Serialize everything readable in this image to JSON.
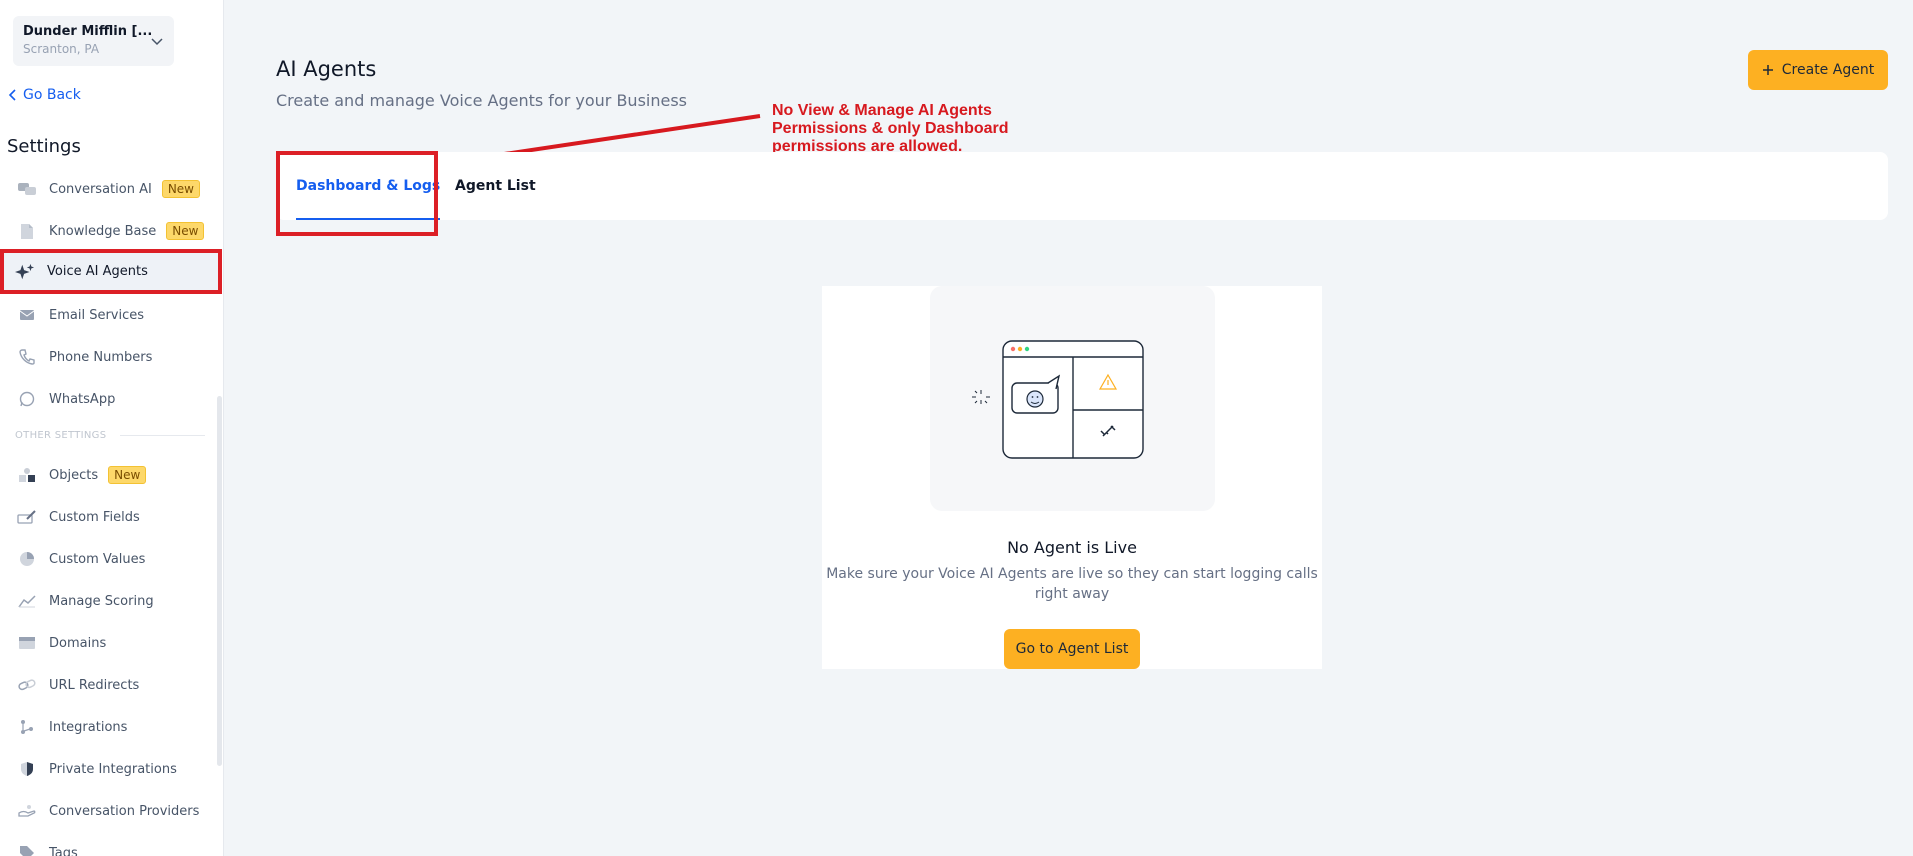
{
  "sidebar": {
    "location_name": "Dunder Mifflin [...",
    "location_sub": "Scranton, PA",
    "go_back": "Go Back",
    "settings_title": "Settings",
    "items": [
      {
        "label": "Conversation AI",
        "badge": "New",
        "icon": "chat-bubbles-icon"
      },
      {
        "label": "Knowledge Base",
        "badge": "New",
        "icon": "document-icon"
      },
      {
        "label": "Voice AI Agents",
        "badge": "",
        "icon": "sparkles-icon"
      },
      {
        "label": "Email Services",
        "badge": "",
        "icon": "envelope-icon"
      },
      {
        "label": "Phone Numbers",
        "badge": "",
        "icon": "phone-icon"
      },
      {
        "label": "WhatsApp",
        "badge": "",
        "icon": "whatsapp-icon"
      }
    ],
    "other_label": "OTHER SETTINGS",
    "other_items": [
      {
        "label": "Objects",
        "badge": "New",
        "icon": "objects-icon"
      },
      {
        "label": "Custom Fields",
        "badge": "",
        "icon": "edit-field-icon"
      },
      {
        "label": "Custom Values",
        "badge": "",
        "icon": "pie-icon"
      },
      {
        "label": "Manage Scoring",
        "badge": "",
        "icon": "chart-line-icon"
      },
      {
        "label": "Domains",
        "badge": "",
        "icon": "server-icon"
      },
      {
        "label": "URL Redirects",
        "badge": "",
        "icon": "link-icon"
      },
      {
        "label": "Integrations",
        "badge": "",
        "icon": "nodes-icon"
      },
      {
        "label": "Private Integrations",
        "badge": "",
        "icon": "shield-icon"
      },
      {
        "label": "Conversation Providers",
        "badge": "",
        "icon": "hand-icon"
      },
      {
        "label": "Tags",
        "badge": "",
        "icon": "tag-icon"
      }
    ]
  },
  "header": {
    "title": "AI Agents",
    "subtitle": "Create and manage Voice Agents for your Business",
    "create_button": "Create Agent"
  },
  "annotation": {
    "lines": [
      "No View & Manage AI Agents",
      "Permissions & only Dashboard",
      "permissions are allowed."
    ],
    "color": "#d7191f"
  },
  "tabs": [
    {
      "label": "Dashboard & Logs",
      "active": true
    },
    {
      "label": "Agent List",
      "active": false
    }
  ],
  "empty_state": {
    "title": "No Agent is Live",
    "description": "Make sure your Voice AI Agents are live so they can start logging calls right away",
    "button": "Go to Agent List"
  },
  "colors": {
    "accent": "#fdb022",
    "primary": "#155eef",
    "highlight": "#dc1f26"
  }
}
